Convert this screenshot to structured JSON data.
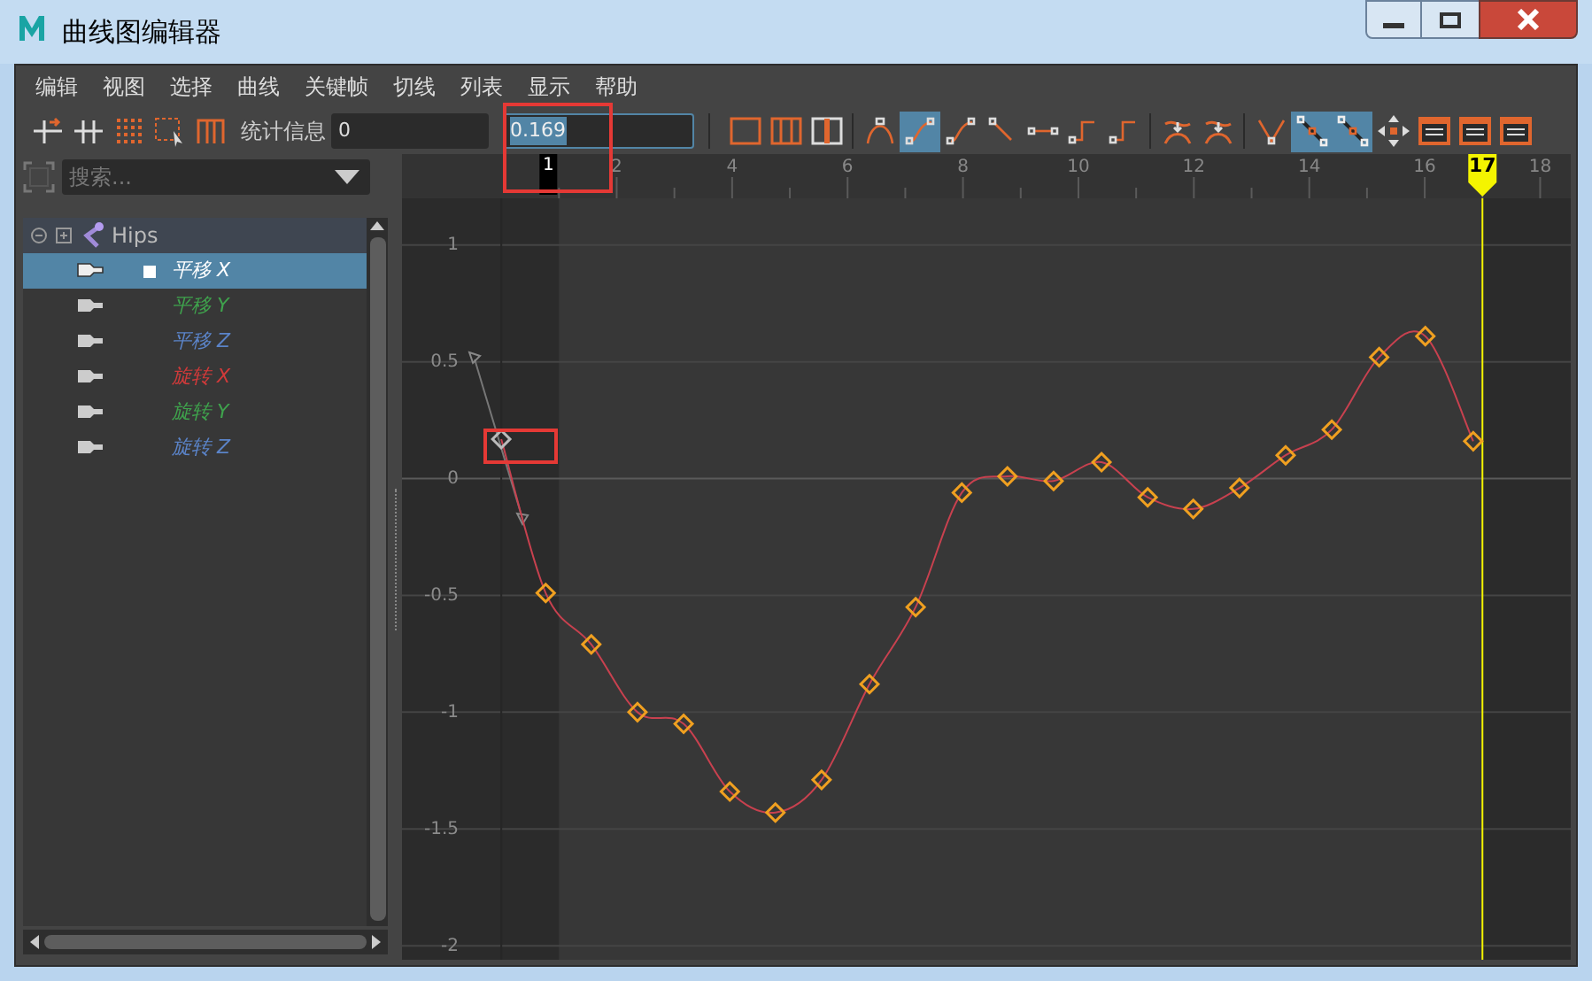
{
  "window": {
    "title": "曲线图编辑器"
  },
  "menu": [
    "编辑",
    "视图",
    "选择",
    "曲线",
    "关键帧",
    "切线",
    "列表",
    "显示",
    "帮助"
  ],
  "toolbar": {
    "left_icons": [
      {
        "kind": "insert",
        "selected": false
      },
      {
        "kind": "split",
        "selected": false
      },
      {
        "kind": "lattice",
        "selected": false
      },
      {
        "kind": "region",
        "selected": false
      },
      {
        "kind": "bracket",
        "selected": false
      }
    ],
    "stats_label": "统计信息",
    "stats_frame": "0",
    "stats_value": "0.169",
    "right_groups": [
      [
        {
          "kind": "frame",
          "selected": false
        },
        {
          "kind": "frame-split",
          "selected": false
        },
        {
          "kind": "frame-center",
          "selected": false
        }
      ],
      [
        {
          "kind": "auto",
          "selected": false
        },
        {
          "kind": "spline",
          "selected": true
        },
        {
          "kind": "clamped",
          "selected": false
        },
        {
          "kind": "linear",
          "selected": false
        },
        {
          "kind": "flat",
          "selected": false
        },
        {
          "kind": "step",
          "selected": false
        },
        {
          "kind": "plateau",
          "selected": false
        }
      ],
      [
        {
          "kind": "buffer",
          "selected": false
        },
        {
          "kind": "buffer",
          "selected": false
        }
      ],
      [
        {
          "kind": "break",
          "selected": false
        },
        {
          "kind": "unify",
          "selected": true
        },
        {
          "kind": "weight",
          "selected": true
        },
        {
          "kind": "move",
          "selected": false
        },
        {
          "kind": "window",
          "selected": false
        },
        {
          "kind": "window",
          "selected": false
        },
        {
          "kind": "window",
          "selected": false
        }
      ]
    ]
  },
  "outliner": {
    "search_placeholder": "搜索...",
    "root": {
      "label": "Hips",
      "expanded": true,
      "children": [
        {
          "label": "平移 X",
          "color": "#ffffff",
          "selected": true
        },
        {
          "label": "平移 Y",
          "color": "#3fa34d",
          "selected": false
        },
        {
          "label": "平移 Z",
          "color": "#5b84c9",
          "selected": false
        },
        {
          "label": "旋转 X",
          "color": "#d23a3a",
          "selected": false
        },
        {
          "label": "旋转 Y",
          "color": "#3fa34d",
          "selected": false
        },
        {
          "label": "旋转 Z",
          "color": "#5b84c9",
          "selected": false
        }
      ]
    }
  },
  "graph": {
    "range_start": "1",
    "chart_data": {
      "type": "line",
      "x": [
        0,
        0.77,
        1.56,
        2.36,
        3.16,
        3.96,
        4.75,
        5.55,
        6.38,
        7.18,
        7.98,
        8.77,
        9.57,
        10.4,
        11.2,
        11.99,
        12.79,
        13.59,
        14.39,
        15.21,
        16.01,
        16.84
      ],
      "series": [
        {
          "color": "#c8414f",
          "marker": "diamond",
          "values": [
            0.169,
            -0.49,
            -0.71,
            -1.0,
            -1.05,
            -1.34,
            -1.43,
            -1.29,
            -0.88,
            -0.55,
            -0.06,
            0.01,
            -0.01,
            0.07,
            -0.08,
            -0.13,
            -0.04,
            0.1,
            0.21,
            0.52,
            0.61,
            0.16
          ]
        }
      ],
      "xlim": [
        -1.72,
        18.53
      ],
      "ylim": [
        -2.06,
        1.2
      ],
      "xticks": [
        2,
        4,
        6,
        8,
        10,
        12,
        14,
        16,
        18
      ],
      "yticks": [
        -2,
        -1.5,
        -1,
        -0.5,
        0,
        0.5,
        1
      ],
      "grid": true,
      "ref_lines": [
        {
          "axis": "x",
          "value": 17,
          "label": "17"
        }
      ]
    }
  }
}
